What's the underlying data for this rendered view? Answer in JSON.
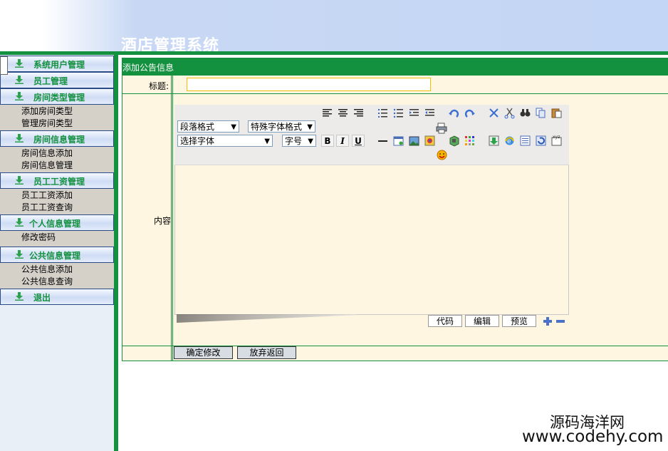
{
  "app": {
    "title": "酒店管理系统"
  },
  "sidebar": {
    "categories": [
      {
        "label": "系统用户管理",
        "subitems": []
      },
      {
        "label": "员工管理",
        "subitems": []
      },
      {
        "label": "房间类型管理",
        "subitems": [
          "添加房间类型",
          "管理房间类型"
        ]
      },
      {
        "label": "房间信息管理",
        "subitems": [
          "房间信息添加",
          "房间信息管理"
        ]
      },
      {
        "label": "员工工资管理",
        "subitems": [
          "员工工资添加",
          "员工工资查询"
        ]
      },
      {
        "label": "个人信息管理",
        "subitems": [
          "修改密码"
        ]
      },
      {
        "label": "公共信息管理",
        "subitems": [
          "公共信息添加",
          "公共信息查询"
        ]
      },
      {
        "label": "退出",
        "subitems": []
      }
    ]
  },
  "form": {
    "header": "添加公告信息",
    "title_label": "标题:",
    "title_value": "",
    "content_label": "内容"
  },
  "editor": {
    "paragraph_select": "段落格式",
    "special_font_select": "特殊字体格式",
    "font_select": "选择字体",
    "size_select": "字号",
    "bold": "B",
    "italic": "I",
    "underline": "U",
    "modes": [
      "代码",
      "编辑",
      "预览"
    ]
  },
  "actions": {
    "submit": "确定修改",
    "cancel": "放弃返回"
  },
  "watermark": {
    "line1": "源码海洋网",
    "line2": "www.codehy.com"
  },
  "colors": {
    "accent": "#13913f",
    "header_bg": "#c4d6f5",
    "form_bg": "#fff6e1"
  }
}
